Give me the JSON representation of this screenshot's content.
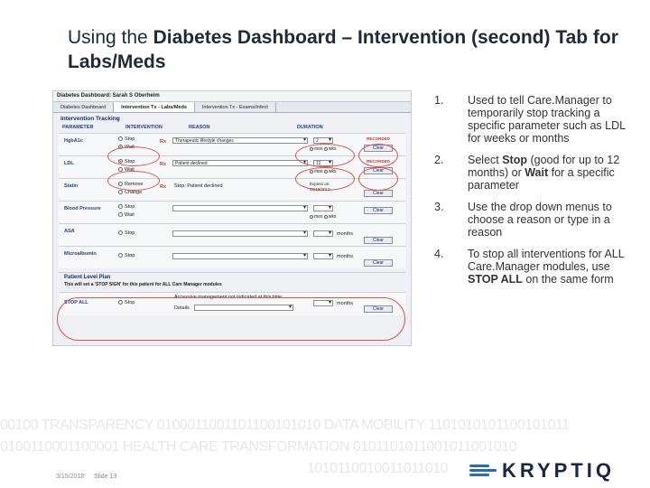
{
  "slide": {
    "title_prefix": "Using the ",
    "title_bold": "Diabetes Dashboard – Intervention (second) Tab for Labs/Meds",
    "footer_date": "3/15/2018",
    "footer_slide": "Slide 13",
    "logo_text": "KRYPTIQ",
    "binary_lines": [
      "00100 TRANSPARENCY 0100011001101100101010 DATA MOBILITY 1101010101100101011",
      "0100110001100001 HEALTH CARE TRANSFORMATION 0101101011001011001010",
      "1010110010011011010"
    ]
  },
  "screenshot": {
    "window_title": "Diabetes Dashboard: Sarah S Oberheim",
    "tabs": [
      "Diabetes Dashboard",
      "Intervention Tx - Labs/Meds",
      "Intervention Tx - Exams/Infect"
    ],
    "section_title": "Intervention Tracking",
    "col_parameter": "PARAMETER",
    "col_intervention": "INTERVENTION",
    "col_reason": "REASON",
    "col_duration": "DURATION",
    "rows": [
      {
        "name": "HgbA1c",
        "opt1": "Stop",
        "opt2": "Wait",
        "reason": "Therapeutic lifestyle changes",
        "dur": "2",
        "u1": "mos",
        "u2": "wks",
        "btn": "Clear",
        "recorded": "RECORDED"
      },
      {
        "name": "LDL",
        "opt1": "Stop",
        "opt2": "Wait",
        "reason": "Patient declined",
        "dur": "12",
        "u1": "mos",
        "u2": "wks",
        "btn": "Clear",
        "recorded": "RECORDED"
      },
      {
        "name": "Statin",
        "opt1": "Remove",
        "opt2": "Change",
        "note": "Stop: Patient declined",
        "expires": "Expires on:",
        "expires_date": "06/18/2013",
        "btn": "Clear"
      },
      {
        "name": "Blood Pressure",
        "opt1": "Stop",
        "opt2": "Wait",
        "u1": "mos",
        "u2": "wks",
        "btn": "Clear"
      },
      {
        "name": "ASA",
        "opt1": "Stop",
        "months": "months",
        "btn": "Clear"
      },
      {
        "name": "Microalbumin",
        "opt1": "Stop",
        "months": "months",
        "btn": "Clear"
      }
    ],
    "plan_title": "Patient Level Plan",
    "plan_note": "This will set a 'STOP SIGN' for this patient for ALL Care Manager modules",
    "stop_all": {
      "name": "STOP ALL",
      "opt1": "Stop",
      "reason": "Accessive management not indicated at this time",
      "details": "Details",
      "months": "months",
      "btn": "Clear"
    },
    "rx": "Rx"
  },
  "list": [
    {
      "num": "1.",
      "text_a": "Used to tell Care.Manager to temporarily stop tracking a specific parameter such as LDL for weeks or months"
    },
    {
      "num": "2.",
      "text_a": "Select ",
      "bold1": "Stop",
      "text_b": " (good for up to 12 months) or ",
      "bold2": "Wait",
      "text_c": " for a specific parameter"
    },
    {
      "num": "3.",
      "text_a": "Use the drop down menus to choose a reason or type in a reason"
    },
    {
      "num": "4.",
      "text_a": "To stop all interventions for ALL Care.Manager modules, use ",
      "bold1": "STOP ALL",
      "text_b": " on the same form"
    }
  ]
}
